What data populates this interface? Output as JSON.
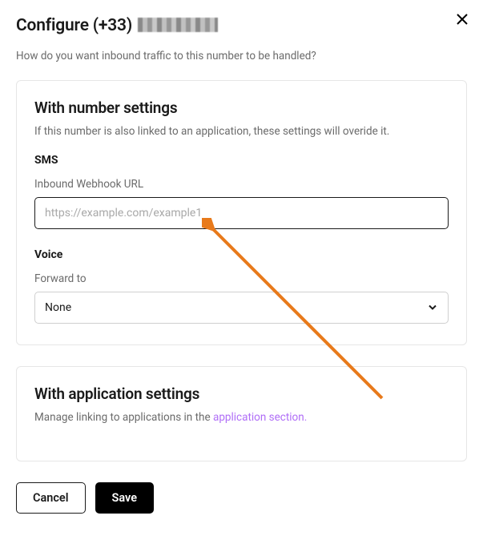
{
  "header": {
    "title_prefix": "Configure (+33)",
    "subtitle": "How do you want inbound traffic to this number to be handled?"
  },
  "number_settings": {
    "heading": "With number settings",
    "desc": "If this number is also linked to an application, these settings will overide it.",
    "sms": {
      "label": "SMS",
      "webhook_label": "Inbound Webhook URL",
      "webhook_placeholder": "https://example.com/example1",
      "webhook_value": ""
    },
    "voice": {
      "label": "Voice",
      "forward_label": "Forward to",
      "selected": "None"
    }
  },
  "app_settings": {
    "heading": "With application settings",
    "desc_prefix": "Manage linking to applications in the ",
    "link_text": "application section.",
    "desc_suffix": ""
  },
  "footer": {
    "cancel": "Cancel",
    "save": "Save"
  }
}
